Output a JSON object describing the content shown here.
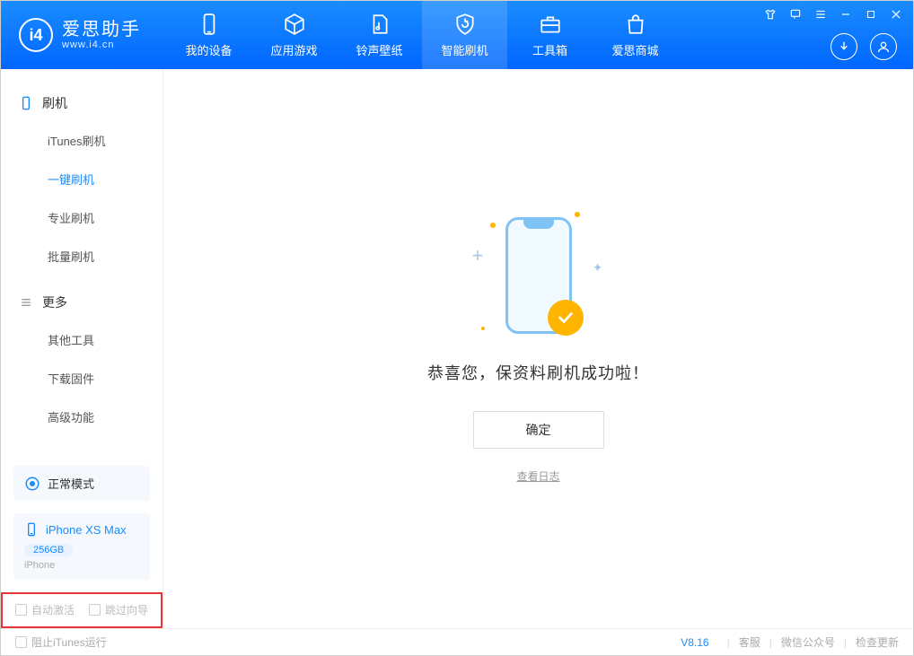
{
  "app": {
    "title": "爱思助手",
    "subtitle": "www.i4.cn"
  },
  "tabs": [
    {
      "label": "我的设备"
    },
    {
      "label": "应用游戏"
    },
    {
      "label": "铃声壁纸"
    },
    {
      "label": "智能刷机"
    },
    {
      "label": "工具箱"
    },
    {
      "label": "爱思商城"
    }
  ],
  "sidebar": {
    "section1": {
      "title": "刷机",
      "items": [
        {
          "label": "iTunes刷机"
        },
        {
          "label": "一键刷机"
        },
        {
          "label": "专业刷机"
        },
        {
          "label": "批量刷机"
        }
      ]
    },
    "section2": {
      "title": "更多",
      "items": [
        {
          "label": "其他工具"
        },
        {
          "label": "下载固件"
        },
        {
          "label": "高级功能"
        }
      ]
    },
    "mode": "正常模式",
    "device": {
      "name": "iPhone XS Max",
      "capacity": "256GB",
      "type": "iPhone"
    },
    "checkboxes": {
      "auto_activate": "自动激活",
      "skip_guide": "跳过向导"
    }
  },
  "main": {
    "success_text": "恭喜您，保资料刷机成功啦！",
    "confirm_btn": "确定",
    "view_log": "查看日志"
  },
  "footer": {
    "block_itunes": "阻止iTunes运行",
    "version": "V8.16",
    "links": {
      "support": "客服",
      "wechat": "微信公众号",
      "check_update": "检查更新"
    }
  }
}
